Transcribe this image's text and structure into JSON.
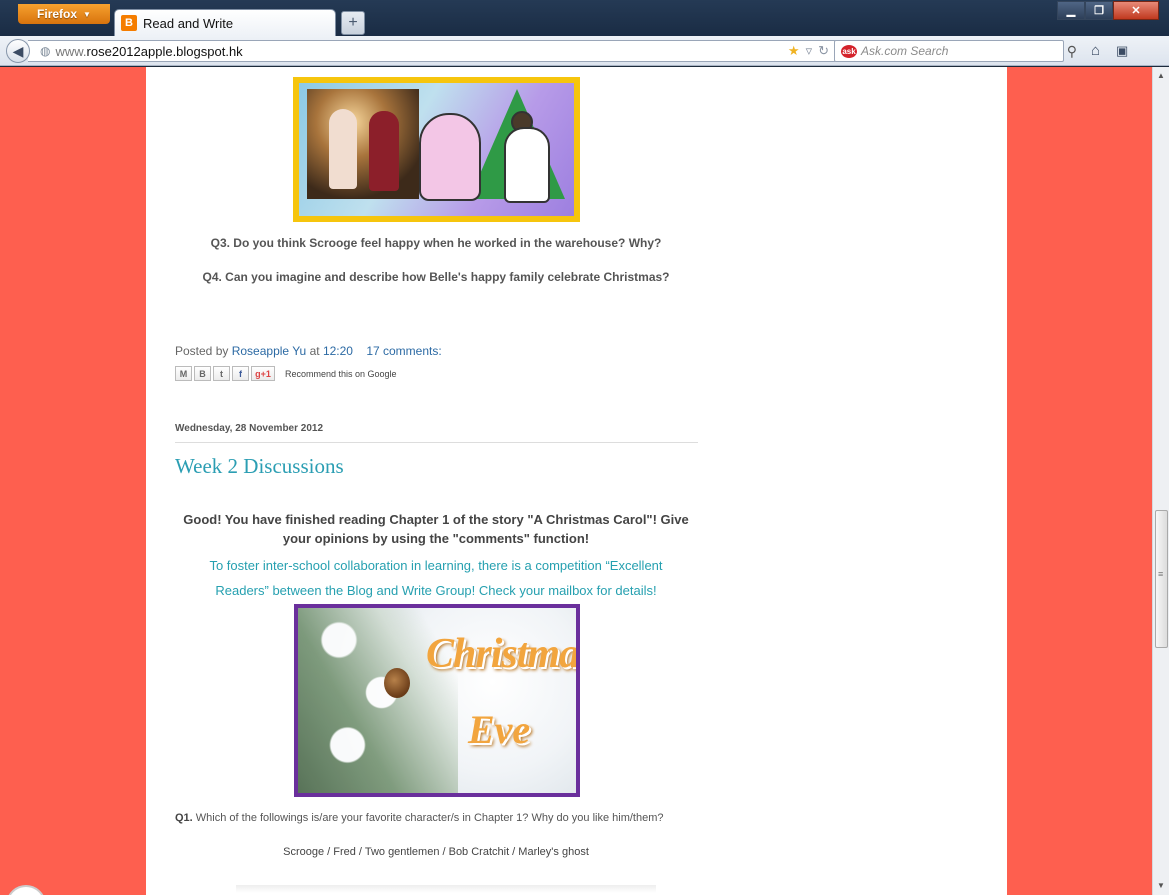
{
  "browser": {
    "menu_button_label": "Firefox",
    "tab_title": "Read and Write",
    "tab_favicon_letter": "B",
    "new_tab_symbol": "+",
    "url_prefix": "www.",
    "url_host": "rose2012apple.blogspot.hk",
    "search_placeholder": "Ask.com Search",
    "icons": [
      "back-arrow-icon",
      "globe-icon",
      "bookmark-star-icon",
      "dropmarker-icon",
      "reload-icon",
      "ask-icon",
      "search-icon",
      "home-icon",
      "bookmarks-icon"
    ],
    "colors": {
      "menu_button": "#e8870f",
      "page_background": "#fe5f4f",
      "accent": "#2b9eb3"
    }
  },
  "post1": {
    "q3": "Q3. Do you think Scrooge feel happy when he worked in the warehouse? Why?",
    "q4": "Q4. Can you imagine and describe how Belle's happy family celebrate Christmas?",
    "footer": {
      "posted_by": "Posted by",
      "author": "Roseapple Yu",
      "at": "at",
      "time": "12:20",
      "comments": "17 comments:"
    },
    "share": {
      "buttons": [
        "M",
        "B",
        "t",
        "f",
        "g+1"
      ],
      "recommend": "Recommend this on Google"
    }
  },
  "post2": {
    "date": "Wednesday, 28 November 2012",
    "title": "Week 2 Discussions",
    "intro_bold_line1": "Good! You have finished reading Chapter 1 of the story \"A Christmas Carol\"! Give",
    "intro_bold_line2": "your opinions by using the \"comments\" function!",
    "intro_teal_line1": "To foster inter-school collaboration in learning, there is a competition “Excellent",
    "intro_teal_line2": "Readers” between the Blog and Write Group! Check your mailbox for details!",
    "image_word1": "Christmas",
    "image_word2": "Eve",
    "q1_label": "Q1.",
    "q1_text": "Which of the followings is/are your favorite character/s in Chapter 1? Why do you like him/them?",
    "choices": "Scrooge / Fred / Two gentlemen / Bob Cratchit / Marley's ghost"
  }
}
